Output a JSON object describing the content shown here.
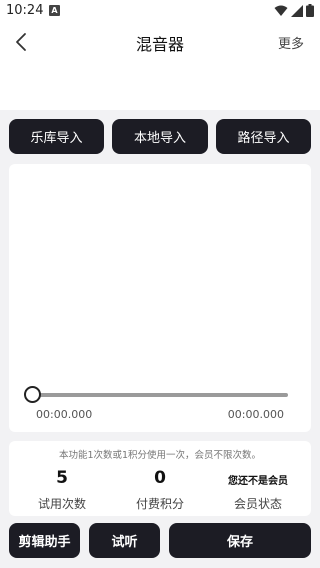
{
  "status_bar": {
    "time": "10:24",
    "notif_glyph": "A"
  },
  "header": {
    "title": "混音器",
    "more_label": "更多"
  },
  "import_buttons": [
    {
      "label": "乐库导入"
    },
    {
      "label": "本地导入"
    },
    {
      "label": "路径导入"
    }
  ],
  "player": {
    "position": 0,
    "start_time": "00:00.000",
    "end_time": "00:00.000"
  },
  "info": {
    "note": "本功能1次数或1积分使用一次，会员不限次数。",
    "stats": [
      {
        "value": "5",
        "label": "试用次数"
      },
      {
        "value": "0",
        "label": "付费积分"
      },
      {
        "value": "您还不是会员",
        "label": "会员状态"
      }
    ]
  },
  "bottom_bar": {
    "assistant_label": "剪辑助手",
    "preview_label": "试听",
    "save_label": "保存"
  },
  "colors": {
    "dark_button": "#1c1c24",
    "page_bg": "#f2f2f4"
  }
}
